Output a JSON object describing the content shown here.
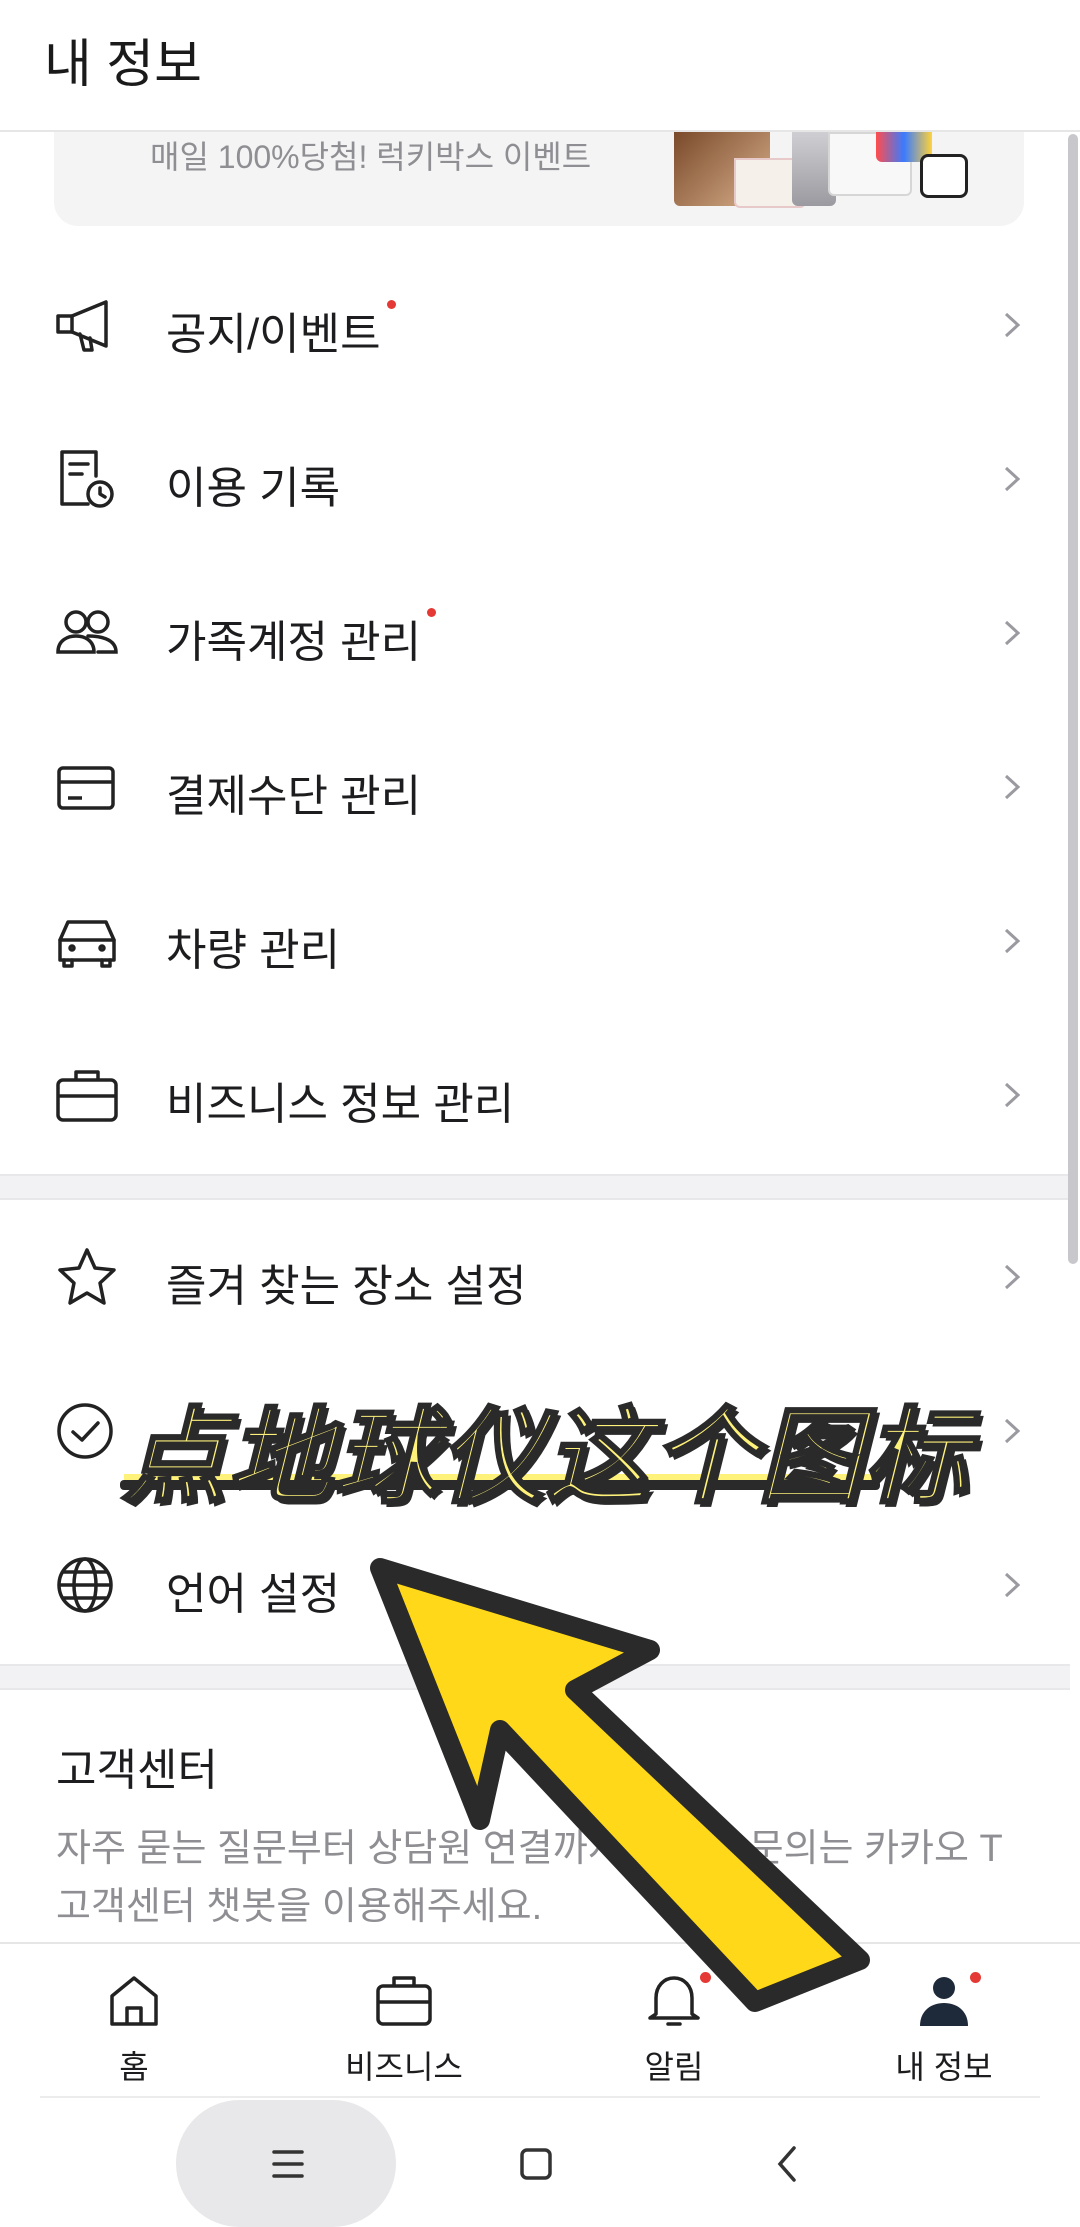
{
  "header": {
    "title": "내 정보"
  },
  "banner": {
    "text": "매일 100%당첨! 럭키박스 이벤트"
  },
  "menu": [
    {
      "label": "공지/이벤트",
      "icon": "megaphone-icon",
      "badge": true
    },
    {
      "label": "이용 기록",
      "icon": "history-icon",
      "badge": false
    },
    {
      "label": "가족계정 관리",
      "icon": "family-icon",
      "badge": true
    },
    {
      "label": "결제수단 관리",
      "icon": "card-icon",
      "badge": false
    },
    {
      "label": "차량 관리",
      "icon": "car-icon",
      "badge": false
    },
    {
      "label": "비즈니스 정보 관리",
      "icon": "briefcase-icon",
      "badge": false
    }
  ],
  "menu2": [
    {
      "label": "즐겨 찾는 장소 설정",
      "icon": "star-icon"
    },
    {
      "label": "",
      "icon": "check-circle-icon"
    },
    {
      "label": "언어 설정",
      "icon": "globe-icon"
    }
  ],
  "support": {
    "title": "고객센터",
    "description": "자주 묻는 질문부터 상담원 연결까지 궁금한 문의는 카카오 T 고객센터 챗봇을 이용해주세요."
  },
  "tabs": [
    {
      "label": "홈",
      "icon": "home-icon",
      "badge": false
    },
    {
      "label": "비즈니스",
      "icon": "briefcase-icon",
      "badge": false
    },
    {
      "label": "알림",
      "icon": "bell-icon",
      "badge": true
    },
    {
      "label": "내 정보",
      "icon": "person-icon",
      "badge": true
    }
  ],
  "overlay": {
    "caption": "点地球仪这个图标"
  },
  "colors": {
    "badge": "#e53935",
    "overlay_text": "#fff27a",
    "arrow": "#ffd81a",
    "outline": "#2a2a2a"
  }
}
